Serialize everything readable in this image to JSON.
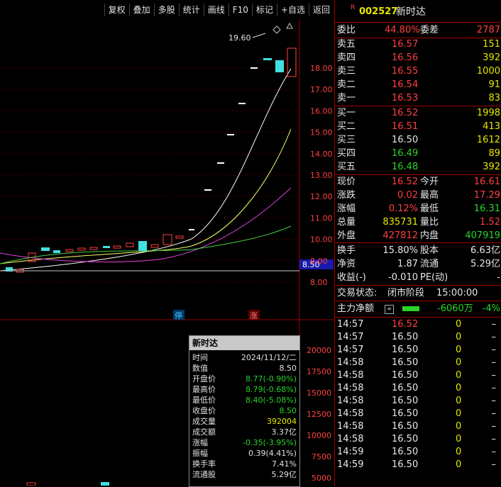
{
  "toolbar": {
    "buttons": [
      "复权",
      "叠加",
      "多股",
      "统计",
      "画线",
      "F10",
      "标记",
      "+自选",
      "返回"
    ]
  },
  "chart": {
    "price_axis": [
      "18.00",
      "17.00",
      "16.00",
      "15.00",
      "14.00",
      "13.00",
      "12.00",
      "11.00",
      "10.00",
      "9.00",
      "8.00"
    ],
    "current_price_tag": "8.50",
    "high_marker": "19.60",
    "badges": [
      "停",
      "涨"
    ],
    "volume_axis": [
      "20000",
      "17500",
      "15000",
      "12500",
      "10000",
      "7500",
      "5000"
    ]
  },
  "popup": {
    "title": "新时达",
    "rows": [
      {
        "label": "时间",
        "value": "2024/11/12/二",
        "color": "#e0e0e0"
      },
      {
        "label": "数值",
        "value": "8.50",
        "color": "#e0e0e0"
      },
      {
        "label": "开盘价",
        "value": "8.77(-0.90%)",
        "color": "#2ad42a"
      },
      {
        "label": "最高价",
        "value": "8.79(-0.68%)",
        "color": "#2ad42a"
      },
      {
        "label": "最低价",
        "value": "8.40(-5.08%)",
        "color": "#2ad42a"
      },
      {
        "label": "收盘价",
        "value": "8.50",
        "color": "#2ad42a"
      },
      {
        "label": "成交量",
        "value": "392004",
        "color": "#e8e800"
      },
      {
        "label": "成交额",
        "value": "3.37亿",
        "color": "#e0e0e0"
      },
      {
        "label": "涨幅",
        "value": "-0.35(-3.95%)",
        "color": "#2ad42a"
      },
      {
        "label": "振幅",
        "value": "0.39(4.41%)",
        "color": "#e0e0e0"
      },
      {
        "label": "换手率",
        "value": "7.41%",
        "color": "#e0e0e0"
      },
      {
        "label": "流通股",
        "value": "5.29亿",
        "color": "#e0e0e0"
      }
    ]
  },
  "panel": {
    "badge": "R",
    "code": "002527",
    "name": "新时达",
    "weibi_label": "委比",
    "weibi": "44.80%",
    "weicha_label": "委差",
    "weicha": "2787",
    "sell": [
      {
        "label": "卖五",
        "price": "16.57",
        "vol": "151"
      },
      {
        "label": "卖四",
        "price": "16.56",
        "vol": "392"
      },
      {
        "label": "卖三",
        "price": "16.55",
        "vol": "1000"
      },
      {
        "label": "卖二",
        "price": "16.54",
        "vol": "91"
      },
      {
        "label": "卖一",
        "price": "16.53",
        "vol": "83"
      }
    ],
    "buy": [
      {
        "label": "买一",
        "price": "16.52",
        "vol": "1998",
        "pc": "red"
      },
      {
        "label": "买二",
        "price": "16.51",
        "vol": "413",
        "pc": "red"
      },
      {
        "label": "买三",
        "price": "16.50",
        "vol": "1612",
        "pc": "white"
      },
      {
        "label": "买四",
        "price": "16.49",
        "vol": "89",
        "pc": "green"
      },
      {
        "label": "买五",
        "price": "16.48",
        "vol": "392",
        "pc": "green"
      }
    ],
    "quote": [
      {
        "l1": "现价",
        "v1": "16.52",
        "c1": "red",
        "l2": "今开",
        "v2": "16.61",
        "c2": "red"
      },
      {
        "l1": "涨跌",
        "v1": "0.02",
        "c1": "red",
        "l2": "最高",
        "v2": "17.29",
        "c2": "red"
      },
      {
        "l1": "涨幅",
        "v1": "0.12%",
        "c1": "red",
        "l2": "最低",
        "v2": "16.31",
        "c2": "green"
      },
      {
        "l1": "总量",
        "v1": "835731",
        "c1": "yellow",
        "l2": "量比",
        "v2": "1.52",
        "c2": "red"
      },
      {
        "l1": "外盘",
        "v1": "427812",
        "c1": "red",
        "l2": "内盘",
        "v2": "407919",
        "c2": "green"
      }
    ],
    "fin": [
      {
        "l1": "换手",
        "v1": "15.80%",
        "l2": "股本",
        "v2": "6.63亿"
      },
      {
        "l1": "净资",
        "v1": "1.87",
        "l2": "流通",
        "v2": "5.29亿"
      },
      {
        "l1": "收益(-)",
        "v1": "-0.010",
        "l2": "PE(动)",
        "v2": "-"
      }
    ],
    "status_label": "交易状态:",
    "status_value": "闭市阶段",
    "status_time": "15:00:00",
    "flow_label": "主力净额",
    "flow_value": "-6060万",
    "flow_pct": "-4%",
    "ticks": [
      {
        "t": "14:57",
        "p": "16.52",
        "pc": "red",
        "v": "0",
        "d": "–"
      },
      {
        "t": "14:57",
        "p": "16.50",
        "pc": "white",
        "v": "0",
        "d": "–"
      },
      {
        "t": "14:57",
        "p": "16.50",
        "pc": "white",
        "v": "0",
        "d": "–"
      },
      {
        "t": "14:58",
        "p": "16.50",
        "pc": "white",
        "v": "0",
        "d": "–"
      },
      {
        "t": "14:58",
        "p": "16.50",
        "pc": "white",
        "v": "0",
        "d": "–"
      },
      {
        "t": "14:58",
        "p": "16.50",
        "pc": "white",
        "v": "0",
        "d": "–"
      },
      {
        "t": "14:58",
        "p": "16.50",
        "pc": "white",
        "v": "0",
        "d": "–"
      },
      {
        "t": "14:58",
        "p": "16.50",
        "pc": "white",
        "v": "0",
        "d": "–"
      },
      {
        "t": "14:58",
        "p": "16.50",
        "pc": "white",
        "v": "0",
        "d": "–"
      },
      {
        "t": "14:58",
        "p": "16.50",
        "pc": "white",
        "v": "0",
        "d": "–"
      },
      {
        "t": "14:59",
        "p": "16.50",
        "pc": "white",
        "v": "0",
        "d": "–"
      },
      {
        "t": "14:59",
        "p": "16.50",
        "pc": "white",
        "v": "0",
        "d": "–"
      }
    ]
  }
}
